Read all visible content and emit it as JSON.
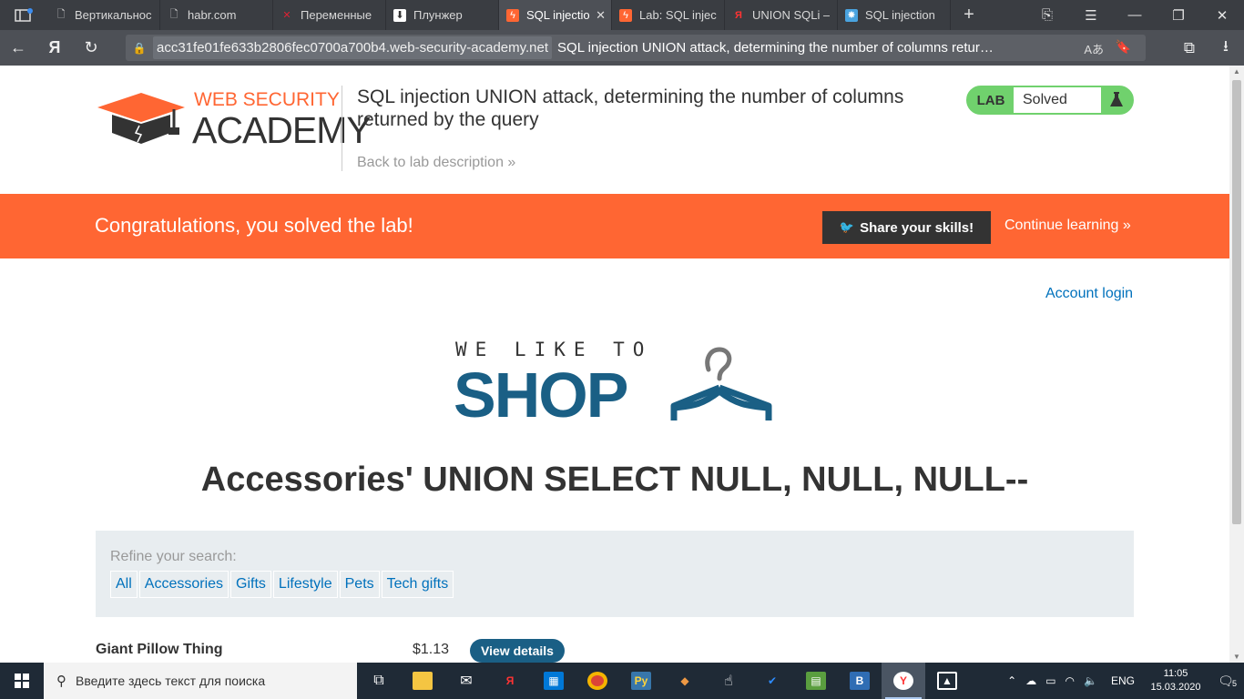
{
  "browser": {
    "tabs": [
      {
        "label": "Вертикальнос",
        "active": false
      },
      {
        "label": "habr.com",
        "active": false
      },
      {
        "label": "Переменные",
        "active": false
      },
      {
        "label": "Плунжер",
        "active": false
      },
      {
        "label": "SQL injectio",
        "active": true
      },
      {
        "label": "Lab: SQL injec",
        "active": false
      },
      {
        "label": "UNION SQLi –",
        "active": false
      },
      {
        "label": "SQL injection",
        "active": false
      }
    ],
    "url_domain": "acc31fe01fe633b2806fec0700a700b4.web-security-academy.net",
    "page_title": "SQL injection UNION attack, determining the number of columns retur…",
    "yandex_button": "Я"
  },
  "lab_header": {
    "logo_line1": "WEB SECURITY",
    "logo_line2": "ACADEMY",
    "title": "SQL injection UNION attack, determining the number of columns returned by the query",
    "back_link": "Back to lab description »",
    "status_lab": "LAB",
    "status_value": "Solved"
  },
  "notification": {
    "message": "Congratulations, you solved the lab!",
    "share_button": "Share your skills!",
    "continue_link": "Continue learning »"
  },
  "shop": {
    "account_login": "Account login",
    "logo_top": "WE LIKE TO",
    "logo_main": "SHOP",
    "category_title": "Accessories' UNION SELECT NULL, NULL, NULL--",
    "refine_label": "Refine your search:",
    "filters": [
      "All",
      "Accessories",
      "Gifts",
      "Lifestyle",
      "Pets",
      "Tech gifts"
    ],
    "products": [
      {
        "name": "Giant Pillow Thing",
        "price": "$1.13",
        "button": "View details"
      }
    ]
  },
  "taskbar": {
    "search_placeholder": "Введите здесь текст для поиска",
    "language": "ENG",
    "time": "11:05",
    "date": "15.03.2020",
    "notification_count": "5"
  },
  "colors": {
    "accent_orange": "#ff6633",
    "shop_blue": "#1a5f85",
    "link_blue": "#0071bc",
    "solved_green": "#70d16d"
  }
}
